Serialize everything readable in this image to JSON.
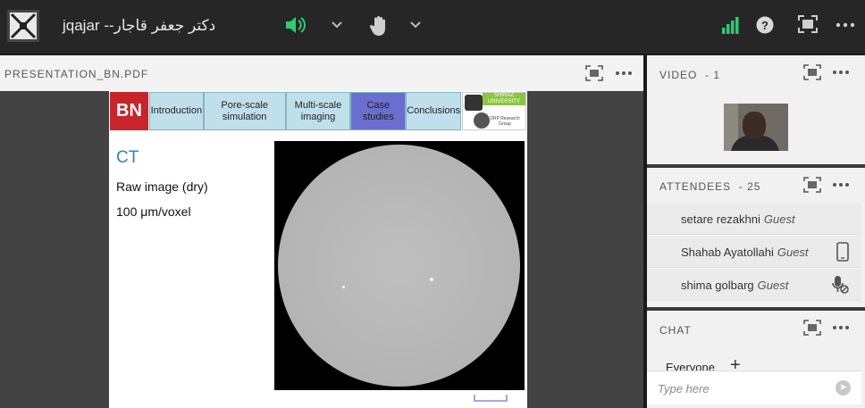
{
  "topbar": {
    "title": "دکتر جعفر قاجار-- jqajar",
    "icons": [
      "app-logo-icon",
      "speaker-icon",
      "chevron-down-icon",
      "hand-raise-icon",
      "signal-bars-icon",
      "help-icon",
      "fullscreen-icon",
      "more-icon"
    ],
    "accent_green": "#2ecc71"
  },
  "presentation": {
    "label": "PRESENTATION_BN.PDF",
    "slide": {
      "logo_text": "BN",
      "nav": [
        {
          "label": "Introduction",
          "active": false
        },
        {
          "label": "Pore-scale simulation",
          "active": false
        },
        {
          "label": "Multi-scale imaging",
          "active": false
        },
        {
          "label": "Case studies",
          "active": true
        },
        {
          "label": "Conclusions",
          "active": false
        }
      ],
      "university_logo": {
        "line1": "SHIRAZ UNIVERSITY",
        "line2": "DRP Research Group"
      },
      "title": "CT",
      "lines": [
        "Raw image (dry)",
        "100 μm/voxel"
      ]
    }
  },
  "video": {
    "label": "VIDEO",
    "count": "- 1"
  },
  "attendees": {
    "label": "ATTENDEES",
    "count": "- 25",
    "list": [
      {
        "name": "setare rezakhni",
        "role": "Guest",
        "icon": ""
      },
      {
        "name": "Shahab Ayatollahi",
        "role": "Guest",
        "icon": "mobile-device-icon"
      },
      {
        "name": "shima golbarg",
        "role": "Guest",
        "icon": "mic-muted-icon"
      }
    ]
  },
  "chat": {
    "label": "CHAT",
    "target": "Everyone",
    "placeholder": "Type here"
  }
}
